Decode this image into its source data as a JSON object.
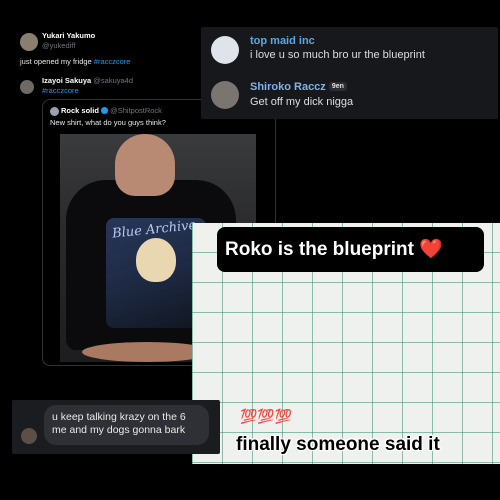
{
  "tweet1": {
    "name": "Yukari Yakumo",
    "handle": "@yukediff",
    "text_prefix": "just opened my fridge ",
    "hashtag": "#racczcore"
  },
  "tweet2": {
    "name": "Izayoi Sakuya",
    "handle": "@sakuya4d",
    "hashtag": "#racczcore"
  },
  "quote": {
    "name": "Rock solid",
    "handle": "@ShitpostRock",
    "text": "New shirt, what do you guys think?",
    "shirt_text": "Blue Archive"
  },
  "discord": {
    "messages": [
      {
        "name": "top maid inc",
        "text": "i love u so much bro ur the blueprint",
        "name_color": "#5aa9e6"
      },
      {
        "name": "Shiroko Raccz",
        "tag": "9en",
        "text": "Get off my dick nigga",
        "name_color": "#7fb2e8"
      }
    ]
  },
  "paper": {
    "caption": "Roko is the blueprint ❤️",
    "emoji": "💯💯💯",
    "bottom_text": "finally someone said it"
  },
  "chat": {
    "text": "u keep talking krazy on the 6 me and my dogs gonna bark"
  }
}
